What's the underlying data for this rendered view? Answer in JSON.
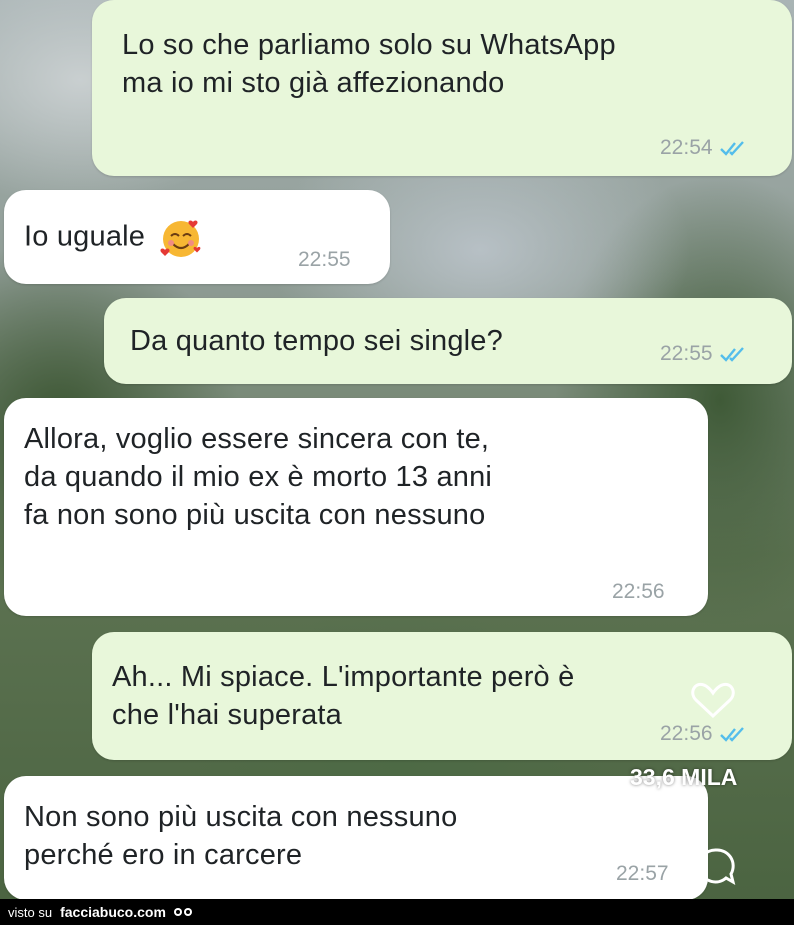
{
  "messages": [
    {
      "type": "sent",
      "lines": [
        "Lo so che parliamo solo su WhatsApp",
        "ma io mi sto già affezionando"
      ],
      "time": "22:54"
    },
    {
      "type": "received",
      "lines": [
        "Io uguale"
      ],
      "time": "22:55",
      "emoji": "smiling-face-with-hearts"
    },
    {
      "type": "sent",
      "lines": [
        "Da quanto tempo sei single?"
      ],
      "time": "22:55"
    },
    {
      "type": "received",
      "lines": [
        "Allora, voglio essere sincera con te,",
        "da quando il mio ex è morto 13 anni",
        "fa non sono più uscita con nessuno"
      ],
      "time": "22:56"
    },
    {
      "type": "sent",
      "lines": [
        "Ah... Mi spiace. L'importante però è",
        "che l'hai superata"
      ],
      "time": "22:56"
    },
    {
      "type": "received",
      "lines": [
        "Non sono più uscita con nessuno",
        "perché ero in carcere"
      ],
      "time": "22:57"
    }
  ],
  "overlay": {
    "views": "33,6 MILA"
  },
  "footer": {
    "prefix": "visto su",
    "site": "facciabuco.com"
  },
  "colors": {
    "sent_bubble": "#e8f7da",
    "received_bubble": "#ffffff",
    "read_ticks": "#53bdeb",
    "time": "#9aa3a6"
  }
}
